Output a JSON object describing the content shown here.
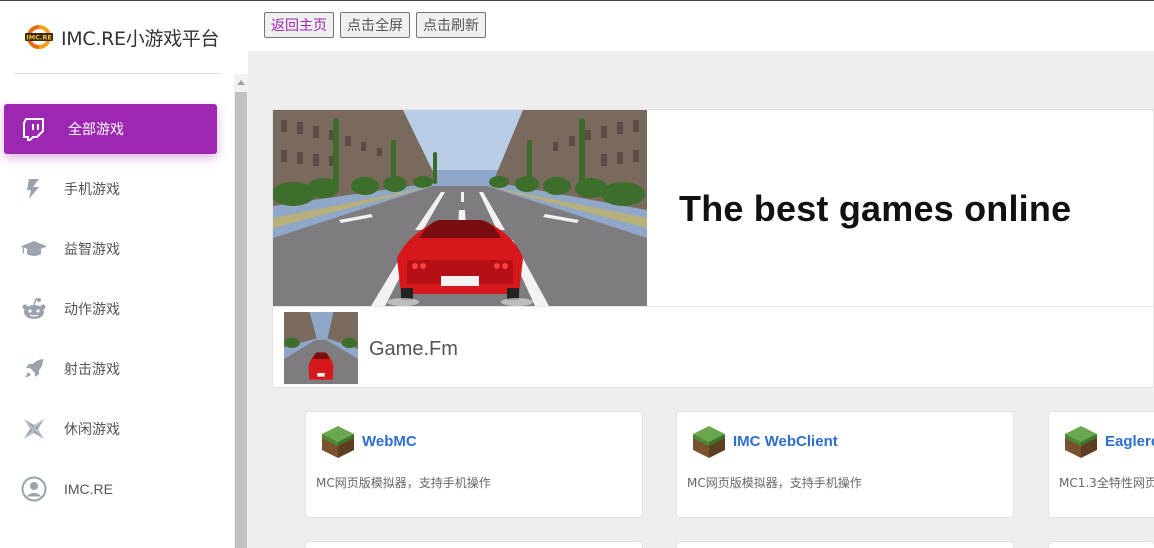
{
  "brand": {
    "title": "IMC.RE小游戏平台",
    "logo_text": "IMC.RE"
  },
  "toolbar": {
    "home_label": "返回主页",
    "fullscreen_label": "点击全屏",
    "refresh_label": "点击刷新"
  },
  "sidebar": {
    "items": [
      {
        "label": "全部游戏",
        "icon": "twitch-icon",
        "active": true
      },
      {
        "label": "手机游戏",
        "icon": "mobile-icon",
        "active": false
      },
      {
        "label": "益智游戏",
        "icon": "graduation-cap-icon",
        "active": false
      },
      {
        "label": "动作游戏",
        "icon": "reddit-icon",
        "active": false
      },
      {
        "label": "射击游戏",
        "icon": "rocket-icon",
        "active": false
      },
      {
        "label": "休闲游戏",
        "icon": "pinwheel-icon",
        "active": false
      },
      {
        "label": "IMC.RE",
        "icon": "user-icon",
        "active": false
      }
    ]
  },
  "hero": {
    "title": "The best games online",
    "name": "Game.Fm"
  },
  "games": [
    {
      "title": "WebMC",
      "desc": "MC网页版模拟器，支持手机操作",
      "icon": "grass-block-icon"
    },
    {
      "title": "IMC WebClient",
      "desc": "MC网页版模拟器，支持手机操作",
      "icon": "grass-block-icon"
    },
    {
      "title": "Eaglerc",
      "desc": "MC1.3全特性网页",
      "icon": "grass-block-icon"
    }
  ],
  "colors": {
    "accent": "#9c27b0",
    "link": "#2c6fcf",
    "background": "#eeeeee"
  }
}
